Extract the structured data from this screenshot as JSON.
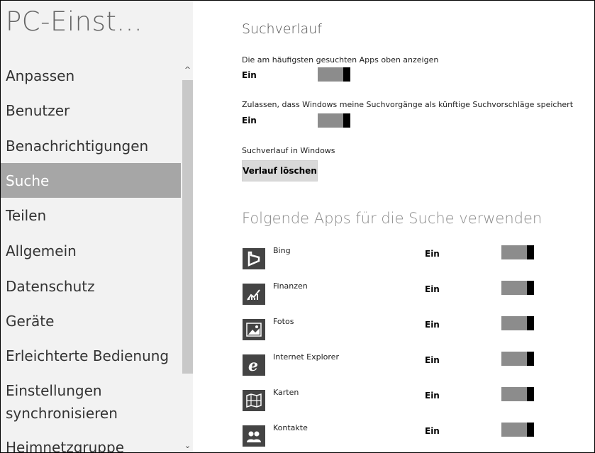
{
  "sidebar": {
    "title": "PC-Einst...",
    "items": [
      {
        "label": "Anpassen"
      },
      {
        "label": "Benutzer"
      },
      {
        "label": "Benachrichtigungen"
      },
      {
        "label": "Suche"
      },
      {
        "label": "Teilen"
      },
      {
        "label": "Allgemein"
      },
      {
        "label": "Datenschutz"
      },
      {
        "label": "Geräte"
      },
      {
        "label": "Erleichterte Bedienung"
      },
      {
        "label_line1": "Einstellungen",
        "label_line2": "synchronisieren"
      },
      {
        "label": "Heimnetzgruppe"
      }
    ],
    "selected_index": 3,
    "scroll_up_glyph": "^",
    "scroll_down_glyph": "⌄"
  },
  "main": {
    "section_title": "Suchverlauf",
    "settings": [
      {
        "label": "Die am häufigsten gesuchten Apps oben anzeigen",
        "state": "Ein",
        "on": true
      },
      {
        "label": "Zulassen, dass Windows meine Suchvorgänge als künftige Suchvorschläge speichert",
        "state": "Ein",
        "on": true
      }
    ],
    "history_label": "Suchverlauf in Windows",
    "clear_button": "Verlauf löschen",
    "apps_title": "Folgende Apps für die Suche verwenden",
    "apps": [
      {
        "name": "Bing",
        "state": "Ein",
        "icon": "bing-icon",
        "on": true
      },
      {
        "name": "Finanzen",
        "state": "Ein",
        "icon": "finance-icon",
        "on": true
      },
      {
        "name": "Fotos",
        "state": "Ein",
        "icon": "photos-icon",
        "on": true
      },
      {
        "name": "Internet Explorer",
        "state": "Ein",
        "icon": "internet-explorer-icon",
        "on": true
      },
      {
        "name": "Karten",
        "state": "Ein",
        "icon": "maps-icon",
        "on": true
      },
      {
        "name": "Kontakte",
        "state": "Ein",
        "icon": "contacts-icon",
        "on": true
      }
    ]
  },
  "colors": {
    "sidebar_bg": "#f2f2f2",
    "selected_bg": "#a6a6a6",
    "icon_bg": "#444444",
    "toggle_fill": "#8c8c8c",
    "toggle_knob": "#000000"
  }
}
